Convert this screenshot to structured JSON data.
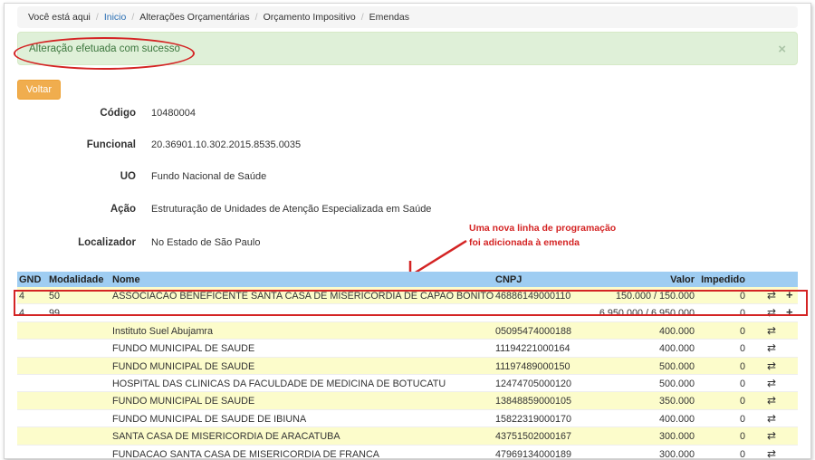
{
  "breadcrumb": {
    "prefix": "Você está aqui",
    "items": [
      "Inicio",
      "Alterações Orçamentárias",
      "Orçamento Impositivo",
      "Emendas"
    ]
  },
  "alert": {
    "message": "Alteração efetuada com sucesso",
    "close": "×"
  },
  "back_button": "Voltar",
  "details": [
    {
      "label": "Código",
      "value": "10480004"
    },
    {
      "label": "Funcional",
      "value": "20.36901.10.302.2015.8535.0035"
    },
    {
      "label": "UO",
      "value": "Fundo Nacional de Saúde"
    },
    {
      "label": "Ação",
      "value": "Estruturação de Unidades de Atenção Especializada em Saúde"
    },
    {
      "label": "Localizador",
      "value": "No Estado de São Paulo"
    }
  ],
  "annotation": [
    "Uma nova linha de programação",
    "foi adicionada à emenda"
  ],
  "table": {
    "headers": {
      "gnd": "GND",
      "modalidade": "Modalidade",
      "nome": "Nome",
      "cnpj": "CNPJ",
      "valor": "Valor",
      "impedido": "Impedido"
    },
    "rows": [
      {
        "gnd": "4",
        "mod": "50",
        "nome": "ASSOCIACAO BENEFICENTE SANTA CASA DE MISERICORDIA DE CAPAO BONITO",
        "cnpj": "46886149000110",
        "valor": "150.000 / 150.000",
        "imp": "0",
        "plus": "+"
      },
      {
        "gnd": "4",
        "mod": "99",
        "nome": "...",
        "cnpj": "...",
        "valor": "6.950.000 / 6.950.000",
        "imp": "0",
        "plus": "+"
      },
      {
        "gnd": "",
        "mod": "",
        "nome": "Instituto Suel Abujamra",
        "cnpj": "05095474000188",
        "valor": "400.000",
        "imp": "0",
        "plus": ""
      },
      {
        "gnd": "",
        "mod": "",
        "nome": "FUNDO MUNICIPAL DE SAUDE",
        "cnpj": "11194221000164",
        "valor": "400.000",
        "imp": "0",
        "plus": ""
      },
      {
        "gnd": "",
        "mod": "",
        "nome": "FUNDO MUNICIPAL DE SAUDE",
        "cnpj": "11197489000150",
        "valor": "500.000",
        "imp": "0",
        "plus": ""
      },
      {
        "gnd": "",
        "mod": "",
        "nome": "HOSPITAL DAS CLINICAS DA FACULDADE DE MEDICINA DE BOTUCATU",
        "cnpj": "12474705000120",
        "valor": "500.000",
        "imp": "0",
        "plus": ""
      },
      {
        "gnd": "",
        "mod": "",
        "nome": "FUNDO MUNICIPAL DE SAUDE",
        "cnpj": "13848859000105",
        "valor": "350.000",
        "imp": "0",
        "plus": ""
      },
      {
        "gnd": "",
        "mod": "",
        "nome": "FUNDO MUNICIPAL DE SAUDE DE IBIUNA",
        "cnpj": "15822319000170",
        "valor": "400.000",
        "imp": "0",
        "plus": ""
      },
      {
        "gnd": "",
        "mod": "",
        "nome": "SANTA CASA DE MISERICORDIA DE ARACATUBA",
        "cnpj": "43751502000167",
        "valor": "300.000",
        "imp": "0",
        "plus": ""
      },
      {
        "gnd": "",
        "mod": "",
        "nome": "FUNDACAO SANTA CASA DE MISERICORDIA DE FRANCA",
        "cnpj": "47969134000189",
        "valor": "300.000",
        "imp": "0",
        "plus": ""
      }
    ]
  },
  "icons": {
    "exchange": "⇄"
  },
  "colors": {
    "alert_bg": "#dff0d8",
    "alert_text": "#3c763d",
    "button": "#f0ad4e",
    "table_header": "#9fcdf2",
    "row_highlight": "#fcfccb",
    "annotation": "#d42424"
  }
}
